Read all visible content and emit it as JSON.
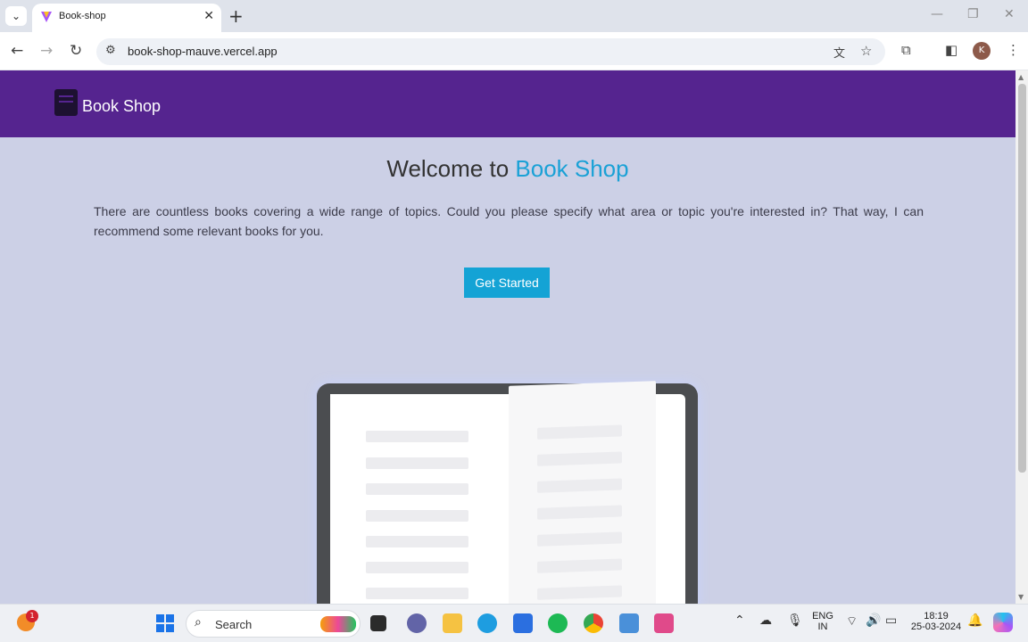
{
  "browser": {
    "tab_title": "Book-shop",
    "url": "book-shop-mauve.vercel.app",
    "profile_initial": "K"
  },
  "page": {
    "brand": "Book Shop",
    "welcome_prefix": "Welcome to ",
    "welcome_accent": "Book Shop",
    "description": "There are countless books covering a wide range of topics. Could you please specify what area or topic you're interested in? That way, I can recommend some relevant books for you.",
    "cta_label": "Get Started"
  },
  "taskbar": {
    "search_placeholder": "Search",
    "notification_count": "1",
    "language_line1": "ENG",
    "language_line2": "IN",
    "time": "18:19",
    "date": "25-03-2024"
  },
  "colors": {
    "nav_bg": "#55248f",
    "page_bg": "#ccd0e6",
    "accent": "#1aa1d6",
    "button_bg": "#14a3d5"
  }
}
